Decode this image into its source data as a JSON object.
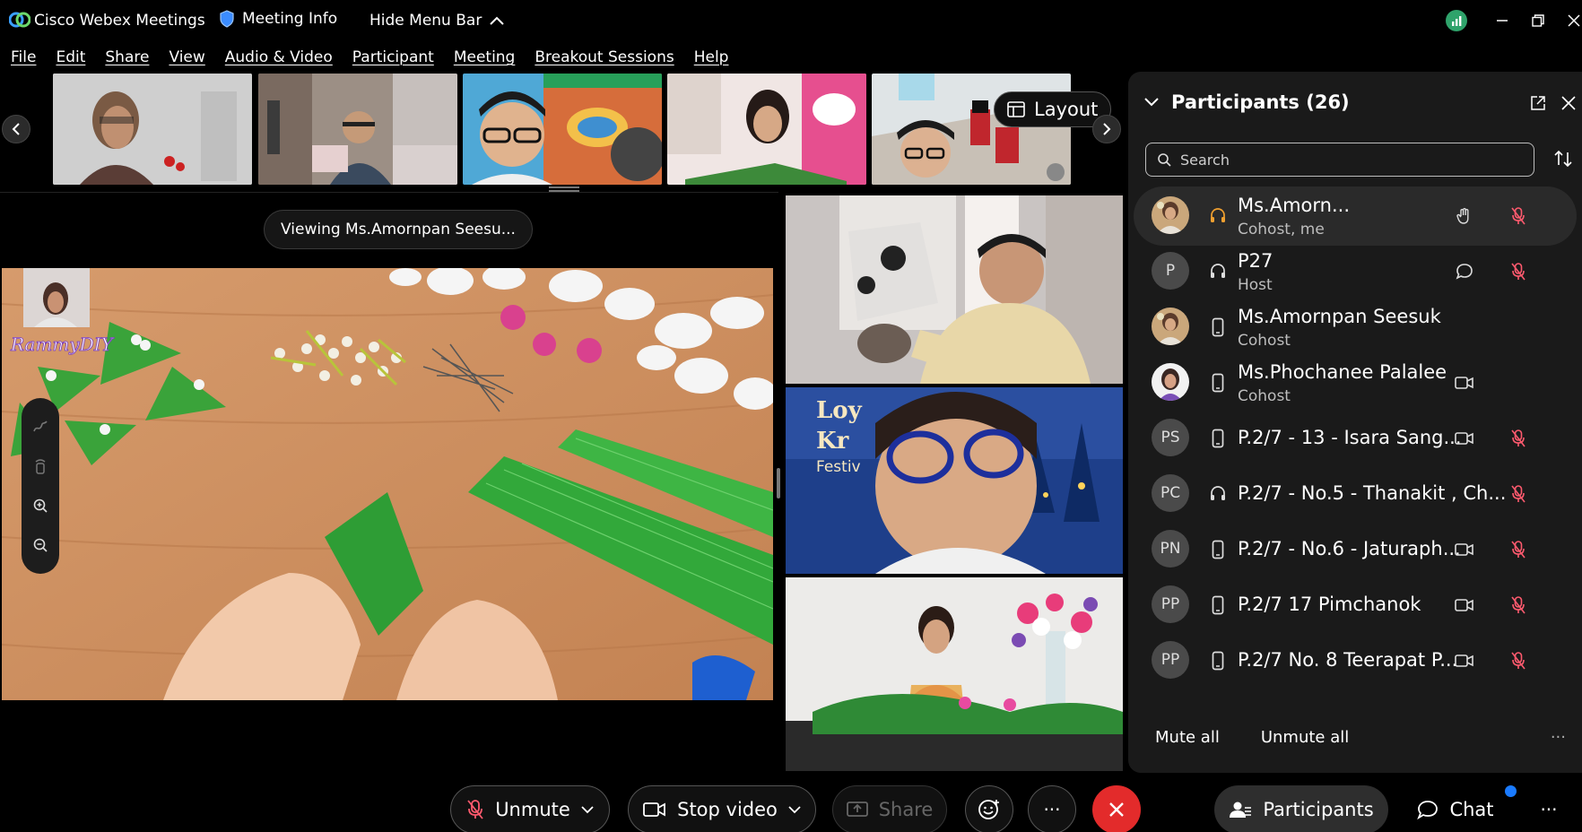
{
  "app": {
    "title": "Cisco Webex Meetings",
    "meeting_info": "Meeting Info",
    "hide_menu": "Hide Menu Bar"
  },
  "menu": [
    "File",
    "Edit",
    "Share",
    "View",
    "Audio & Video",
    "Participant",
    "Meeting",
    "Breakout Sessions",
    "Help"
  ],
  "strip": {
    "layout_label": "Layout",
    "thumbnails": [
      {
        "scene": "teacher with glasses, red flowers"
      },
      {
        "scene": "boy at desk in room"
      },
      {
        "scene": "boy with glasses, colorful drawing"
      },
      {
        "scene": "girl with banana leaves, hello kitty"
      },
      {
        "scene": "boy with glasses, roblox blocks"
      }
    ]
  },
  "stage": {
    "viewing_label": "Viewing Ms.Amornpan Seesu...",
    "overlay_brand": "RammyDIY"
  },
  "tiles": [
    {
      "scene": "boy in cream thai costume"
    },
    {
      "scene": "boy with blue glasses, festival background",
      "overlay": "Loy Kr Festiv"
    },
    {
      "scene": "girl in pink thai dress with flowers"
    }
  ],
  "panel": {
    "title": "Participants (26)",
    "search_placeholder": "Search",
    "participants": [
      {
        "name": "Ms.Amorn...",
        "role": "Cohost, me",
        "initials": "",
        "avatar": "photo-teacher",
        "device": "headset-icon",
        "icon_a": "raise-hand-icon",
        "icon_b": "mic-muted-icon",
        "me": true
      },
      {
        "name": "P27",
        "role": "Host",
        "initials": "P",
        "avatar": "initials",
        "device": "headset-icon",
        "icon_a": "chat-bubble-icon",
        "icon_b": "mic-muted-icon"
      },
      {
        "name": "Ms.Amornpan Seesuk",
        "role": "Cohost",
        "initials": "",
        "avatar": "photo-teacher",
        "device": "phone-icon",
        "icon_a": "",
        "icon_b": ""
      },
      {
        "name": "Ms.Phochanee Palalee",
        "role": "Cohost",
        "initials": "",
        "avatar": "photo-woman",
        "device": "phone-icon",
        "icon_a": "video-icon",
        "icon_b": ""
      },
      {
        "name": "P.2/7 - 13 - Isara Sang...",
        "role": "",
        "initials": "PS",
        "avatar": "initials",
        "device": "phone-icon",
        "icon_a": "video-icon",
        "icon_b": "mic-muted-icon"
      },
      {
        "name": "P.2/7 - No.5 - Thanakit , Ch...",
        "role": "",
        "initials": "PC",
        "avatar": "initials",
        "device": "headset-icon",
        "icon_a": "",
        "icon_b": "mic-muted-icon"
      },
      {
        "name": "P.2/7 - No.6 - Jaturaph...",
        "role": "",
        "initials": "PN",
        "avatar": "initials",
        "device": "phone-icon",
        "icon_a": "video-icon",
        "icon_b": "mic-muted-icon"
      },
      {
        "name": "P.2/7 17 Pimchanok",
        "role": "",
        "initials": "PP",
        "avatar": "initials",
        "device": "phone-icon",
        "icon_a": "video-icon",
        "icon_b": "mic-muted-icon"
      },
      {
        "name": "P.2/7 No. 8 Teerapat P...",
        "role": "",
        "initials": "PP",
        "avatar": "initials",
        "device": "phone-icon",
        "icon_a": "video-icon",
        "icon_b": "mic-muted-icon"
      }
    ],
    "mute_all": "Mute all",
    "unmute_all": "Unmute all"
  },
  "controls": {
    "unmute": "Unmute",
    "stop_video": "Stop video",
    "share": "Share",
    "participants": "Participants",
    "chat": "Chat"
  },
  "colors": {
    "end_call": "#e32b2b",
    "accent_blue": "#1a7bff",
    "muted_red": "#ff5a6e",
    "panel_bg": "#1a1a1a"
  }
}
